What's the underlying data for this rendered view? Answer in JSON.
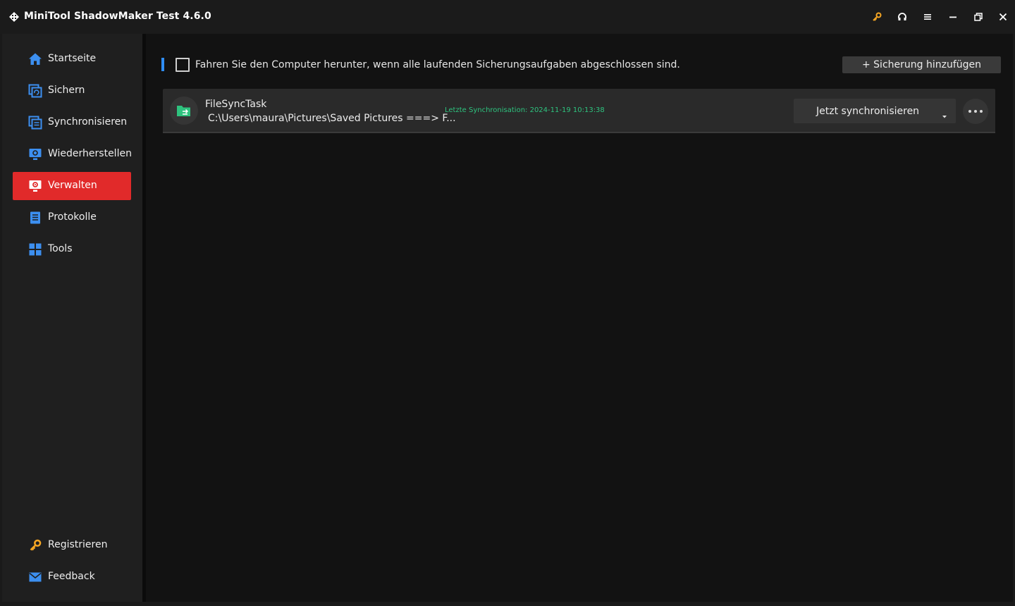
{
  "app": {
    "title": "MiniTool ShadowMaker Test 4.6.0",
    "icons": [
      "logo-icon",
      "key-icon",
      "headset-icon",
      "menu-icon",
      "minimize-icon",
      "restore-icon",
      "close-icon"
    ],
    "colors": {
      "accent_red": "#e12a2a",
      "accent_blue": "#2f8df5",
      "key_orange": "#f5a623",
      "sync_green": "#2ec27e"
    }
  },
  "sidebar": {
    "items": [
      {
        "label": "Startseite",
        "icon": "home-icon",
        "active": false
      },
      {
        "label": "Sichern",
        "icon": "backup-icon",
        "active": false
      },
      {
        "label": "Synchronisieren",
        "icon": "sync-icon",
        "active": false
      },
      {
        "label": "Wiederherstellen",
        "icon": "restore-monitor-icon",
        "active": false
      },
      {
        "label": "Verwalten",
        "icon": "manage-icon",
        "active": true
      },
      {
        "label": "Protokolle",
        "icon": "log-icon",
        "active": false
      },
      {
        "label": "Tools",
        "icon": "tools-icon",
        "active": false
      }
    ],
    "bottom": [
      {
        "label": "Registrieren",
        "icon": "key-icon"
      },
      {
        "label": "Feedback",
        "icon": "mail-icon"
      }
    ]
  },
  "main": {
    "shutdown_checkbox": {
      "label": "Fahren Sie den Computer herunter, wenn alle laufenden Sicherungsaufgaben abgeschlossen sind.",
      "checked": false
    },
    "add_backup_label": "+ Sicherung hinzufügen",
    "tasks": [
      {
        "name": "FileSyncTask",
        "path": "C:\\Users\\maura\\Pictures\\Saved Pictures ===> F...",
        "last_sync": "Letzte Synchronisation: 2024-11-19 10:13:38",
        "action_label": "Jetzt synchronisieren",
        "icon": "folder-sync-icon"
      }
    ]
  }
}
